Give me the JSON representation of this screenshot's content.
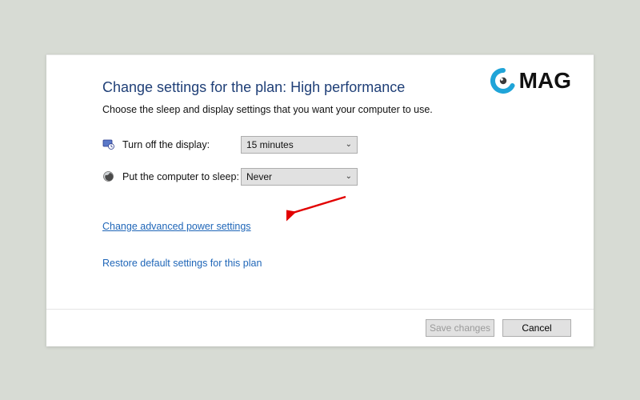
{
  "logo": {
    "text": "MAG"
  },
  "title": "Change settings for the plan: High performance",
  "subtitle": "Choose the sleep and display settings that you want your computer to use.",
  "rows": {
    "display": {
      "label": "Turn off the display:",
      "value": "15 minutes"
    },
    "sleep": {
      "label": "Put the computer to sleep:",
      "value": "Never"
    }
  },
  "links": {
    "advanced": "Change advanced power settings",
    "restore": "Restore default settings for this plan"
  },
  "buttons": {
    "save": "Save changes",
    "cancel": "Cancel"
  },
  "annotation": {
    "arrow_color": "#e20000"
  }
}
